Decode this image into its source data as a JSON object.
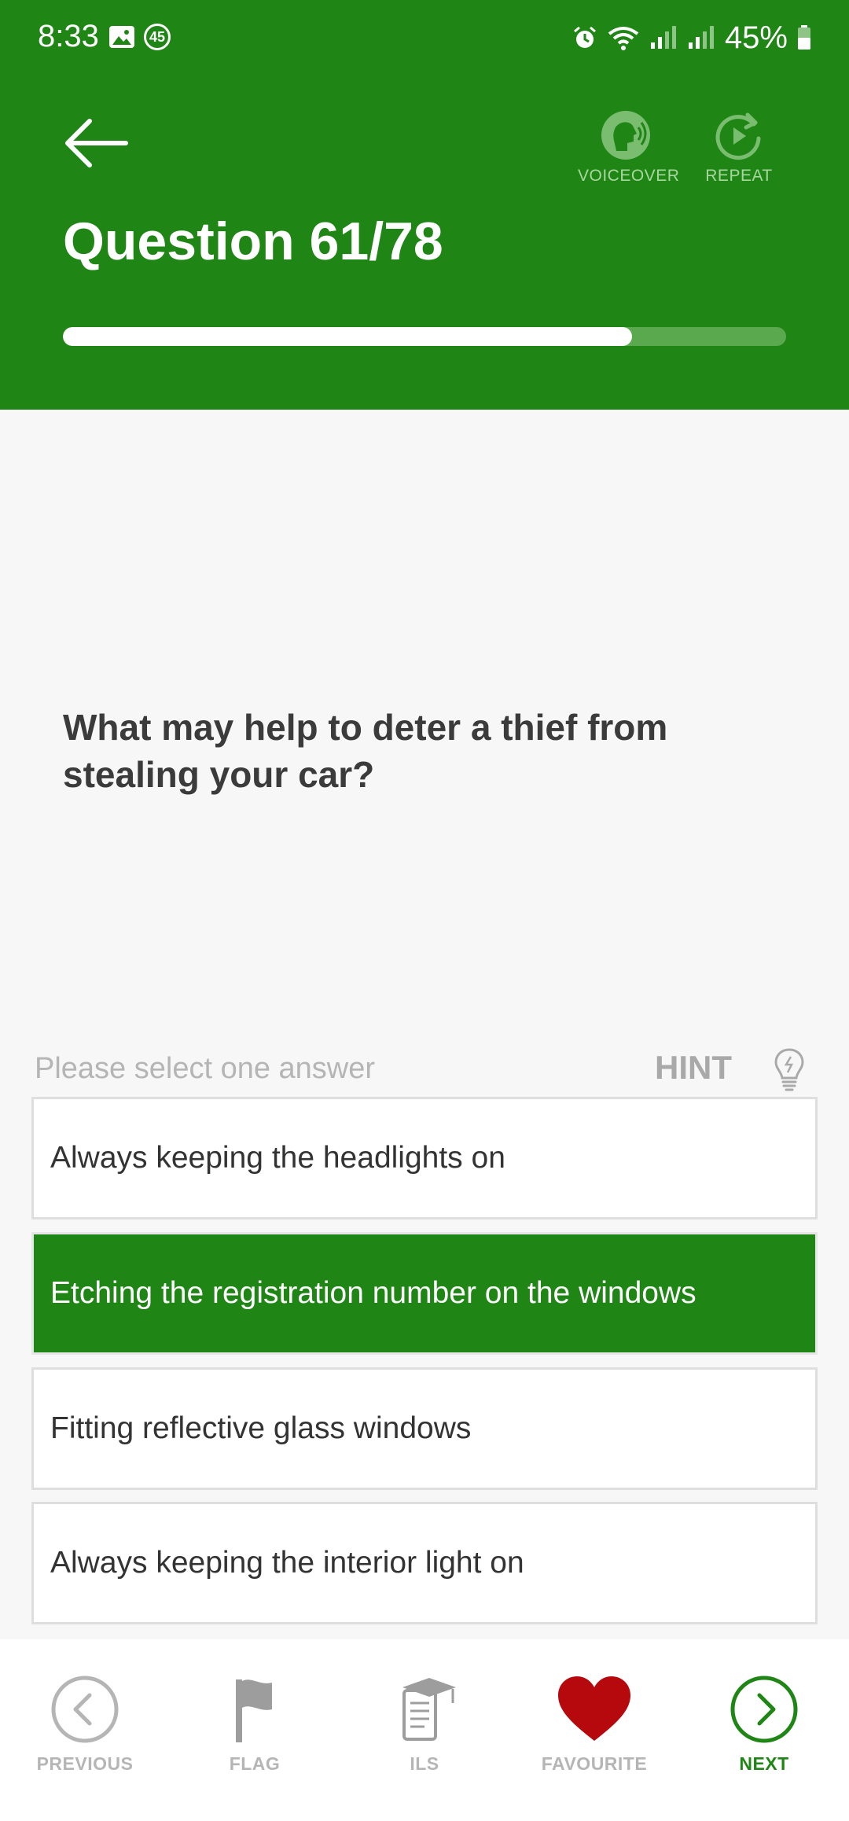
{
  "status_bar": {
    "time": "8:33",
    "notification_count": "45",
    "battery": "45%"
  },
  "header": {
    "voiceover_label": "VOICEOVER",
    "repeat_label": "REPEAT",
    "title": "Question 61/78",
    "progress_fraction": 0.787
  },
  "question": {
    "text": "What may help to deter a thief from stealing your car?"
  },
  "answers_section": {
    "prompt": "Please select one answer",
    "hint_label": "HINT"
  },
  "answers": [
    {
      "label": "Always keeping the headlights on",
      "selected": false
    },
    {
      "label": "Etching the registration number on the windows",
      "selected": true
    },
    {
      "label": "Fitting reflective glass windows",
      "selected": false
    },
    {
      "label": "Always keeping the interior light on",
      "selected": false
    }
  ],
  "bottom_nav": {
    "previous": "PREVIOUS",
    "flag": "FLAG",
    "ils": "ILS",
    "favourite": "FAVOURITE",
    "next": "NEXT"
  },
  "colors": {
    "brand_green": "#1f8615",
    "favourite_red": "#b5090d"
  }
}
